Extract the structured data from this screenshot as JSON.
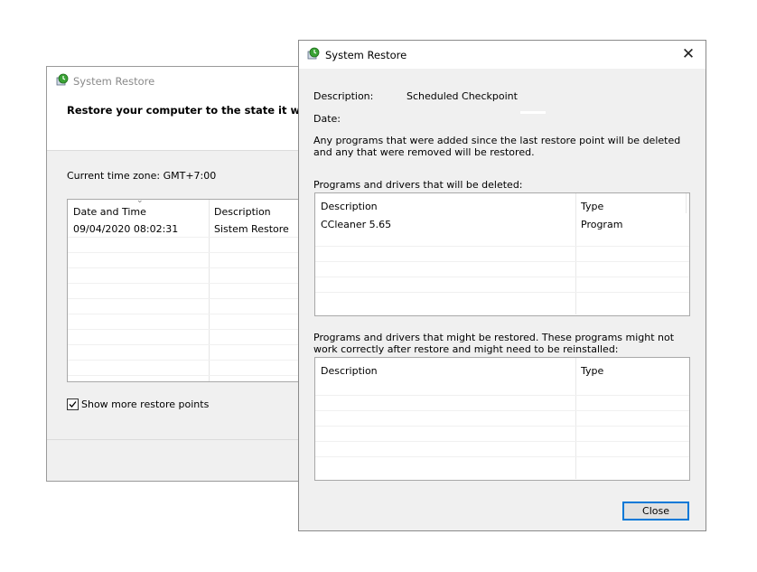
{
  "back_window": {
    "title": "System Restore",
    "heading": "Restore your computer to the state it was in b",
    "timezone": "Current time zone: GMT+7:00",
    "columns": [
      "Date and Time",
      "Description"
    ],
    "rows": [
      {
        "date": "09/04/2020 08:02:31",
        "description": "Sistem Restore"
      }
    ],
    "show_more_label": "Show more restore points",
    "show_more_checked": true
  },
  "front_window": {
    "title": "System Restore",
    "description_label": "Description:",
    "description_value": "Scheduled Checkpoint",
    "date_label": "Date:",
    "info_text": "Any programs that were added since the last restore point will be deleted and any that were removed will be restored.",
    "deleted_section_label": "Programs and drivers that will be deleted:",
    "deleted_columns": [
      "Description",
      "Type"
    ],
    "deleted_items": [
      {
        "description": "CCleaner 5.65",
        "type": "Program"
      }
    ],
    "restored_section_label": "Programs and drivers that might be restored. These programs might not work correctly after restore and might need to be reinstalled:",
    "restored_columns": [
      "Description",
      "Type"
    ],
    "restored_items": [],
    "close_label": "Close"
  }
}
